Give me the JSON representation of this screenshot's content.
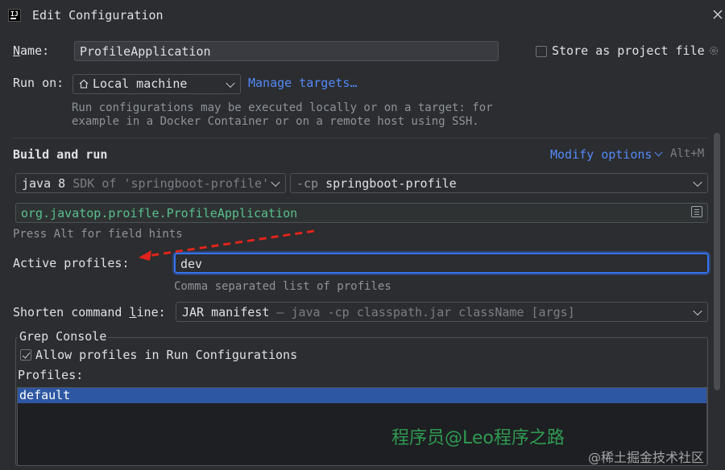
{
  "window": {
    "title": "Edit Configuration",
    "app_icon_text": "IJ"
  },
  "name": {
    "label": "Name:",
    "value": "ProfileApplication",
    "store_label": "Store as project file"
  },
  "run_on": {
    "label": "Run on:",
    "value": "Local machine",
    "manage_link": "Manage targets…",
    "hint_line1": "Run configurations may be executed locally or on a target: for",
    "hint_line2": "example in a Docker Container or on a remote host using SSH."
  },
  "build": {
    "heading": "Build and run",
    "modify_link": "Modify options",
    "modify_shortcut": "Alt+M",
    "jdk_main": "java 8",
    "jdk_detail": "SDK of 'springboot-profile'",
    "cp_prefix": "-cp",
    "cp_value": "springboot-profile",
    "main_class": "org.javatop.proifle.ProfileApplication",
    "field_hint": "Press Alt for field hints"
  },
  "profiles": {
    "label": "Active profiles:",
    "value": "dev",
    "hint": "Comma separated list of profiles"
  },
  "shorten": {
    "label": "Shorten command line:",
    "value": "JAR manifest",
    "detail": "– java -cp classpath.jar className [args]"
  },
  "grep": {
    "title": "Grep Console",
    "allow_label": "Allow profiles in Run Configurations",
    "allow_checked": true,
    "profiles_label": "Profiles:",
    "items": [
      "default"
    ]
  },
  "watermarks": {
    "author": "程序员@Leo程序之路",
    "site": "@稀土掘金技术社区"
  },
  "colors": {
    "link": "#548af7",
    "main_class": "#57c08b",
    "selection": "#2e57a3",
    "focus": "#3574f0",
    "arrow": "#e0241b"
  }
}
